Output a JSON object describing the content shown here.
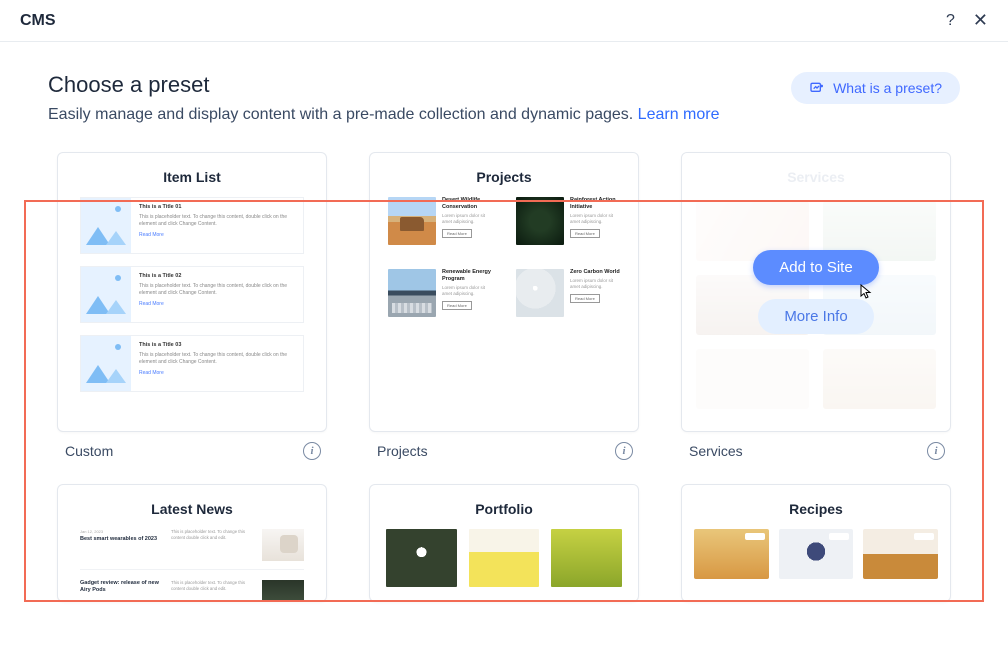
{
  "header": {
    "title": "CMS"
  },
  "intro": {
    "heading": "Choose a preset",
    "subtext": "Easily manage and display content with a pre-made collection and dynamic pages. ",
    "learn_more": "Learn more"
  },
  "preset_button": "What is a preset?",
  "hover_actions": {
    "add": "Add to Site",
    "info": "More Info"
  },
  "presets": [
    {
      "card_title": "Item List",
      "footer_label": "Custom",
      "items": [
        {
          "title": "This is a Title 01",
          "desc": "This is placeholder text. To change this content, double click on the element and click Change Content.",
          "read_more": "Read More"
        },
        {
          "title": "This is a Title 02",
          "desc": "This is placeholder text. To change this content, double click on the element and click Change Content.",
          "read_more": "Read More"
        },
        {
          "title": "This is a Title 03",
          "desc": "This is placeholder text. To change this content, double click on the element and click Change Content.",
          "read_more": "Read More"
        }
      ]
    },
    {
      "card_title": "Projects",
      "footer_label": "Projects",
      "items": [
        {
          "title": "Desert Wildlife Conservation",
          "btn": "Read More"
        },
        {
          "title": "Rainforest Action Initiative",
          "btn": "Read More"
        },
        {
          "title": "Renewable Energy Program",
          "btn": "Read More"
        },
        {
          "title": "Zero Carbon World",
          "btn": "Read More"
        }
      ]
    },
    {
      "card_title": "Services",
      "footer_label": "Services"
    },
    {
      "card_title": "Latest News",
      "footer_label": "",
      "items": [
        {
          "date": "Jan 12, 2023",
          "title": "Best smart wearables of 2023"
        },
        {
          "date": "",
          "title": "Gadget review: release of new Airy Pods"
        }
      ]
    },
    {
      "card_title": "Portfolio",
      "footer_label": ""
    },
    {
      "card_title": "Recipes",
      "footer_label": ""
    }
  ]
}
